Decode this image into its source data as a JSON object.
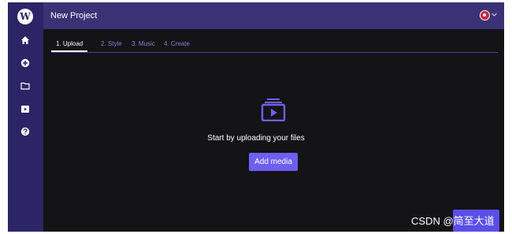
{
  "app": {
    "logo_letter": "W",
    "title": "New Project"
  },
  "sidebar": {
    "items": [
      {
        "icon": "home-icon"
      },
      {
        "icon": "add-circle-icon"
      },
      {
        "icon": "folder-icon"
      },
      {
        "icon": "media-library-icon"
      },
      {
        "icon": "help-icon"
      }
    ]
  },
  "tabs": [
    {
      "label": "1. Upload",
      "active": true
    },
    {
      "label": "2. Style",
      "active": false
    },
    {
      "label": "3. Music",
      "active": false
    },
    {
      "label": "4. Create",
      "active": false
    }
  ],
  "main": {
    "prompt": "Start by uploading your files",
    "add_media_label": "Add media"
  },
  "watermark": "CSDN @简至大道",
  "colors": {
    "sidebar_bg": "#2b2566",
    "topbar_bg": "#3b3275",
    "canvas_bg": "#141316",
    "accent": "#6e5ff0",
    "tab_inactive": "#8580d8",
    "avatar": "#c8253b"
  }
}
